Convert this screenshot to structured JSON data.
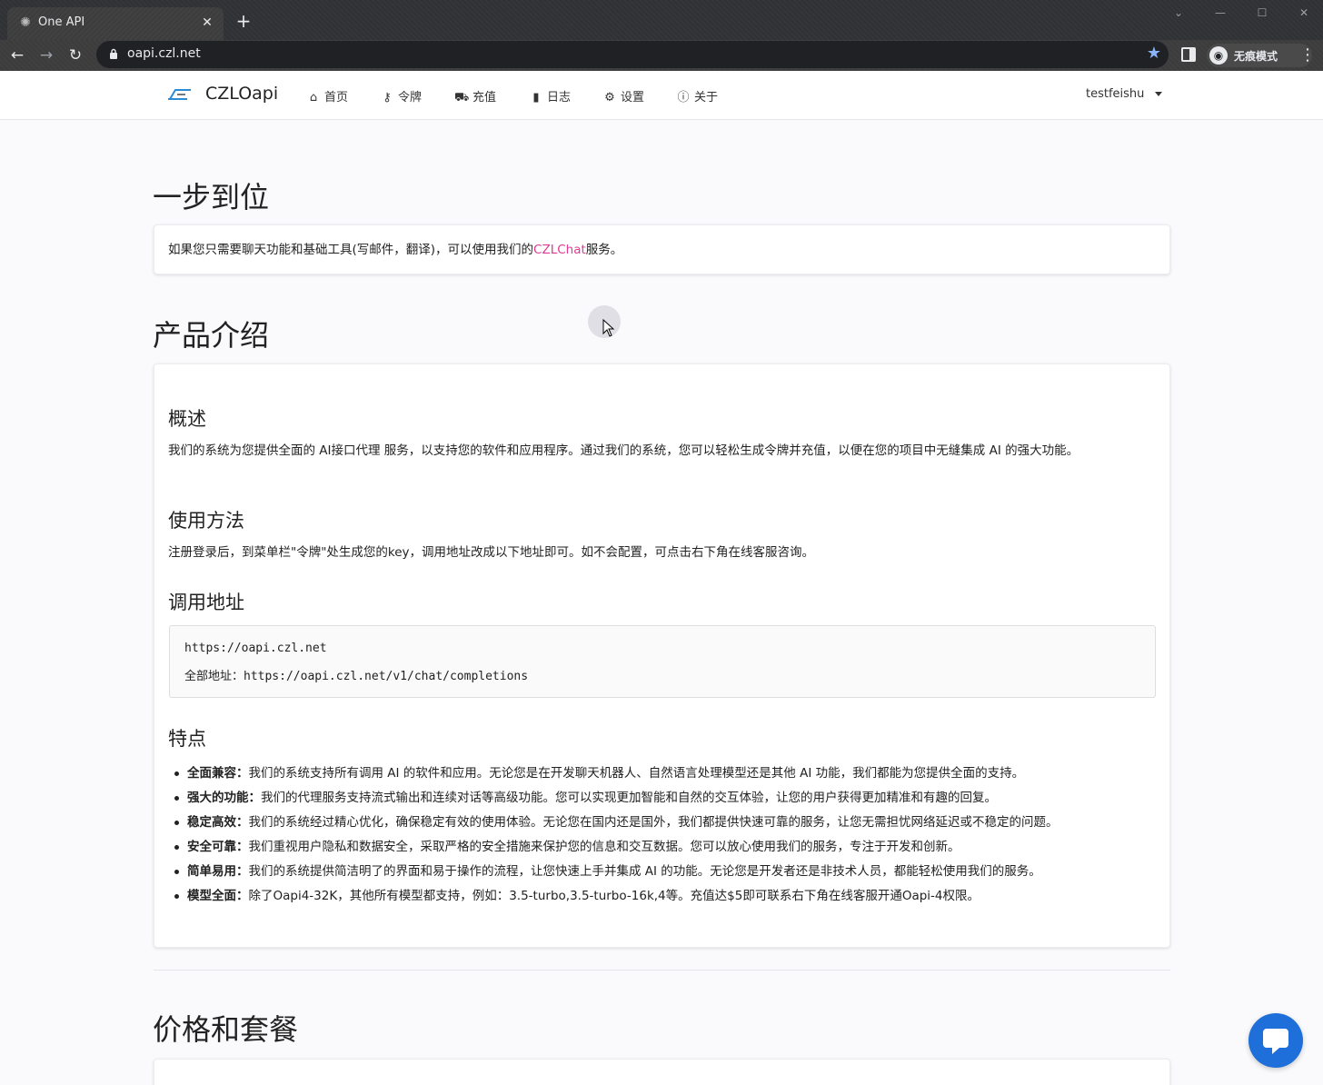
{
  "browser": {
    "tab_title": "One API",
    "tab_close": "✕",
    "new_tab": "+",
    "url": "oapi.czl.net",
    "incognito_label": "无痕模式"
  },
  "site": {
    "brand": "CZLOapi",
    "nav": [
      {
        "label": "首页",
        "icon": "home-icon"
      },
      {
        "label": "令牌",
        "icon": "key-icon"
      },
      {
        "label": "充值",
        "icon": "cart-icon"
      },
      {
        "label": "日志",
        "icon": "book-icon"
      },
      {
        "label": "设置",
        "icon": "gear-icon"
      },
      {
        "label": "关于",
        "icon": "info-icon"
      }
    ],
    "user": "testfeishu"
  },
  "sections": {
    "quick": {
      "title": "一步到位",
      "text_before": "如果您只需要聊天功能和基础工具(写邮件，翻译)，可以使用我们的",
      "link": "CZLChat",
      "text_after": "服务。"
    },
    "intro": {
      "title": "产品介绍",
      "overview_title": "概述",
      "overview_text": "我们的系统为您提供全面的 AI接口代理 服务，以支持您的软件和应用程序。通过我们的系统，您可以轻松生成令牌并充值，以便在您的项目中无缝集成 AI 的强大功能。",
      "usage_title": "使用方法",
      "usage_text": "注册登录后，到菜单栏\"令牌\"处生成您的key，调用地址改成以下地址即可。如不会配置，可点击右下角在线客服咨询。",
      "address_title": "调用地址",
      "address_line1": "https://oapi.czl.net",
      "address_line2": "全部地址：https://oapi.czl.net/v1/chat/completions",
      "features_title": "特点",
      "features": [
        {
          "name": "全面兼容：",
          "text": "我们的系统支持所有调用 AI 的软件和应用。无论您是在开发聊天机器人、自然语言处理模型还是其他 AI 功能，我们都能为您提供全面的支持。"
        },
        {
          "name": "强大的功能：",
          "text": "我们的代理服务支持流式输出和连续对话等高级功能。您可以实现更加智能和自然的交互体验，让您的用户获得更加精准和有趣的回复。"
        },
        {
          "name": "稳定高效：",
          "text": "我们的系统经过精心优化，确保稳定有效的使用体验。无论您在国内还是国外，我们都提供快速可靠的服务，让您无需担忧网络延迟或不稳定的问题。"
        },
        {
          "name": "安全可靠：",
          "text": "我们重视用户隐私和数据安全，采取严格的安全措施来保护您的信息和交互数据。您可以放心使用我们的服务，专注于开发和创新。"
        },
        {
          "name": "简单易用：",
          "text": "我们的系统提供简洁明了的界面和易于操作的流程，让您快速上手并集成 AI 的功能。无论您是开发者还是非技术人员，都能轻松使用我们的服务。"
        },
        {
          "name": "模型全面：",
          "text": "除了Oapi4-32K，其他所有模型都支持，例如：3.5-turbo,3.5-turbo-16k,4等。充值达$5即可联系右下角在线客服开通Oapi-4权限。"
        }
      ]
    },
    "pricing": {
      "title": "价格和套餐"
    }
  },
  "colors": {
    "link_pink": "#e03997",
    "chat_blue": "#1e6fd9",
    "star_blue": "#8ab4f8"
  }
}
